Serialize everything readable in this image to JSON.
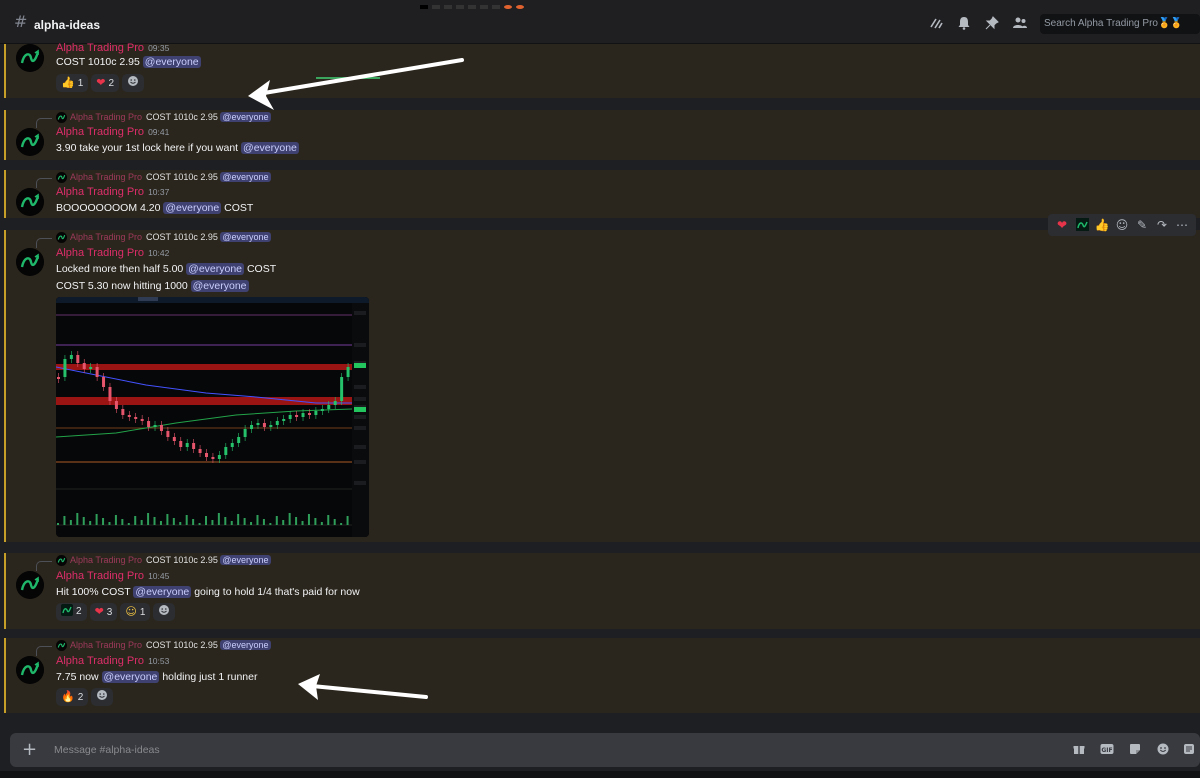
{
  "header": {
    "channel": "alpha-ideas",
    "search_placeholder": "Search Alpha Trading Pro🏅🏅",
    "icons": [
      "threads-icon",
      "bell-icon",
      "pin-icon",
      "members-icon"
    ]
  },
  "author": "Alpha Trading Pro",
  "reply_ref": {
    "author": "Alpha Trading Pro",
    "text": "COST 1010c 2.95",
    "mention": "@everyone"
  },
  "messages": [
    {
      "time": "09:35",
      "lines": [
        {
          "before": "COST 1010c 2.95 ",
          "mention": "@everyone",
          "after": ""
        }
      ],
      "reactions": [
        {
          "icon": "thumbs-up-icon",
          "glyph": "👍",
          "count": "1"
        },
        {
          "icon": "heart-icon",
          "glyph": "❤",
          "count": "2"
        }
      ]
    },
    {
      "time": "09:41",
      "lines": [
        {
          "before": "3.90  take your 1st lock here if you want ",
          "mention": "@everyone",
          "after": ""
        }
      ]
    },
    {
      "time": "10:37",
      "lines": [
        {
          "before": "BOOOOOOOOM 4.20 ",
          "mention": "@everyone",
          "after": " COST"
        }
      ]
    },
    {
      "time": "10:42",
      "lines": [
        {
          "before": "Locked more then half 5.00 ",
          "mention": "@everyone",
          "after": " COST"
        },
        {
          "before": "COST 5.30 now hitting 1000 ",
          "mention": "@everyone",
          "after": ""
        }
      ]
    },
    {
      "time": "10:45",
      "lines": [
        {
          "before": "Hit 100% COST ",
          "mention": "@everyone",
          "after": " going to hold 1/4 that's paid for now"
        }
      ],
      "reactions": [
        {
          "icon": "alpha-logo-icon",
          "glyph": "",
          "count": "2"
        },
        {
          "icon": "heart-icon",
          "glyph": "❤",
          "count": "3"
        },
        {
          "icon": "face-emoji-icon",
          "glyph": "☺",
          "count": "1"
        }
      ]
    },
    {
      "time": "10:53",
      "lines": [
        {
          "before": "7.75 now ",
          "mention": "@everyone",
          "after": " holding just 1 runner"
        }
      ],
      "reactions": [
        {
          "icon": "fire-icon",
          "glyph": "🔥",
          "count": "2"
        }
      ]
    }
  ],
  "hover_toolbar": [
    "heart-icon",
    "alpha-logo-icon",
    "thumbs-up-icon",
    "add-reaction-icon",
    "edit-icon",
    "reply-icon",
    "more-icon"
  ],
  "composer": {
    "placeholder": "Message #alpha-ideas",
    "icons": [
      "gift-icon",
      "gif-icon",
      "sticker-icon",
      "emoji-icon",
      "apps-icon"
    ]
  },
  "colors": {
    "author": "#dd2e6a",
    "highlight_bg": "#2b261d",
    "highlight_border": "#c59f27",
    "mention_bg": "#3f4270",
    "mention_text": "#c9cdfb"
  }
}
